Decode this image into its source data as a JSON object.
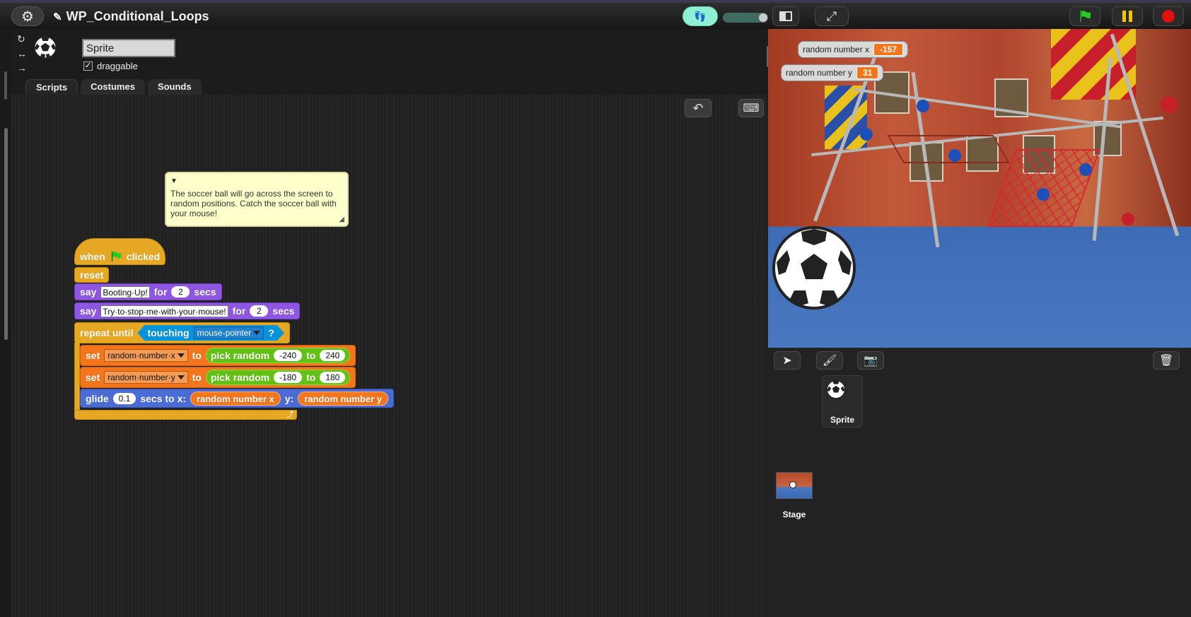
{
  "topbar": {
    "project_title": "WP_Conditional_Loops"
  },
  "sprite": {
    "name": "Sprite",
    "draggable_label": "draggable",
    "draggable_checked": "✓"
  },
  "tabs": [
    "Scripts",
    "Costumes",
    "Sounds"
  ],
  "comment": {
    "text": "The soccer ball will go across the screen to random positions. Catch the soccer ball with your mouse!"
  },
  "script": {
    "hat": {
      "when": "when",
      "clicked": "clicked"
    },
    "reset": "reset",
    "say1": {
      "say": "say",
      "text": "Booting·Up!",
      "for": "for",
      "secs_val": "2",
      "secs": "secs"
    },
    "say2": {
      "say": "say",
      "text": "Try·to·stop·me·with·your·mouse!",
      "for": "for",
      "secs_val": "2",
      "secs": "secs"
    },
    "repeat": {
      "label": "repeat until",
      "touching": "touching",
      "target": "mouse-pointer",
      "q": "?"
    },
    "setx": {
      "set": "set",
      "var": "random·number·x",
      "to": "to",
      "pick": "pick random",
      "from": "-240",
      "to2": "to",
      "max": "240"
    },
    "sety": {
      "set": "set",
      "var": "random·number·y",
      "to": "to",
      "pick": "pick random",
      "from": "-180",
      "to2": "to",
      "max": "180"
    },
    "glide": {
      "glide": "glide",
      "secs_val": "0.1",
      "secs_to_x": "secs to x:",
      "xvar": "random number x",
      "y": "y:",
      "yvar": "random number y"
    }
  },
  "watchers": [
    {
      "label": "random number x",
      "value": "-157"
    },
    {
      "label": "random number y",
      "value": "31"
    }
  ],
  "corral": {
    "sprite_label": "Sprite",
    "stage_label": "Stage"
  },
  "colors": {
    "control": "#e6a822",
    "looks": "#8f56e3",
    "variables": "#f3761d",
    "motion": "#4a6cd4",
    "sensing": "#0494dc",
    "operators": "#62c213"
  }
}
